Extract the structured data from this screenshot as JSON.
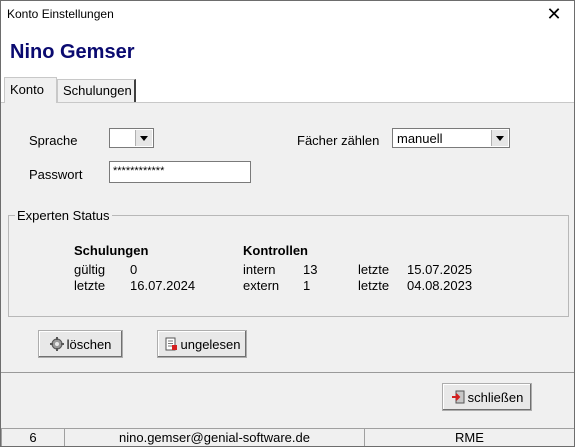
{
  "window": {
    "title": "Konto Einstellungen",
    "close_glyph": "✕"
  },
  "header": {
    "user_name": "Nino Gemser"
  },
  "tabs": [
    {
      "label": "Konto"
    },
    {
      "label": "Schulungen"
    }
  ],
  "form": {
    "language_label": "Sprache",
    "language_value": "",
    "password_label": "Passwort",
    "password_value": "************",
    "count_label": "Fächer zählen",
    "count_value": "manuell"
  },
  "expert_status": {
    "legend": "Experten Status",
    "schulungen": {
      "header": "Schulungen",
      "rows": [
        {
          "label": "gültig",
          "value": "0"
        },
        {
          "label": "letzte",
          "value": "16.07.2024"
        }
      ]
    },
    "kontrollen": {
      "header": "Kontrollen",
      "rows": [
        {
          "label": "intern",
          "count": "13",
          "last_label": "letzte",
          "date": "15.07.2025"
        },
        {
          "label": "extern",
          "count": "1",
          "last_label": "letzte",
          "date": "04.08.2023"
        }
      ]
    }
  },
  "buttons": {
    "delete": "löschen",
    "unread": "ungelesen",
    "close": "schließen"
  },
  "icons": {
    "delete": "gear-icon",
    "unread": "document-icon",
    "close": "exit-door-icon",
    "dropdown": "chevron-down-icon"
  },
  "statusbar": {
    "count": "6",
    "email": "nino.gemser@genial-software.de",
    "code": "RME"
  },
  "colors": {
    "name": "#0a0a70",
    "close_icon": "#d42020"
  }
}
